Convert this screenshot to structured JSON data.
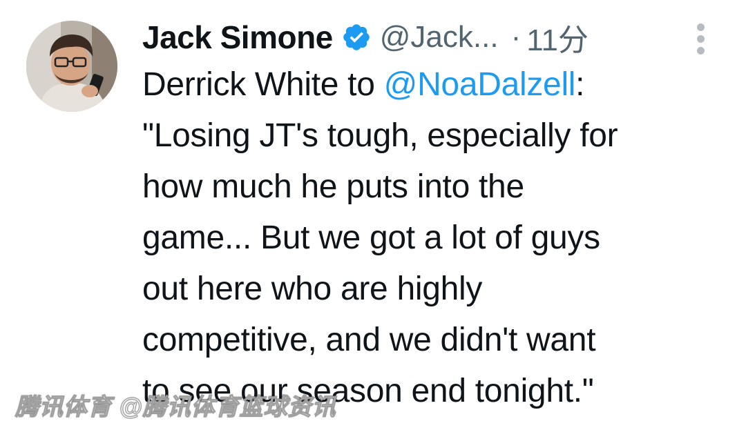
{
  "author": {
    "display_name": "Jack Simone",
    "verified": true,
    "handle": "@Jack...",
    "separator": "·",
    "timestamp": "11分"
  },
  "tweet": {
    "lines": [
      {
        "before": "Derrick White to ",
        "mention": "@NoaDalzell",
        "after": ":"
      },
      {
        "text": "\"Losing JT's tough, especially for"
      },
      {
        "text": "how much he puts into the"
      },
      {
        "text": "game... But we got a lot of guys"
      },
      {
        "text": "out here who are highly"
      },
      {
        "text": "competitive, and we didn't want"
      },
      {
        "text": "to see our season end tonight.\""
      }
    ]
  },
  "watermark": {
    "text": "腾讯体育 @腾讯体育篮球资讯"
  },
  "colors": {
    "accent": "#1d9bf0",
    "text": "#0f1419",
    "muted": "#536471",
    "background": "#ffffff"
  },
  "icons": {
    "verified": "verified-badge-icon",
    "more": "more-options-icon"
  }
}
